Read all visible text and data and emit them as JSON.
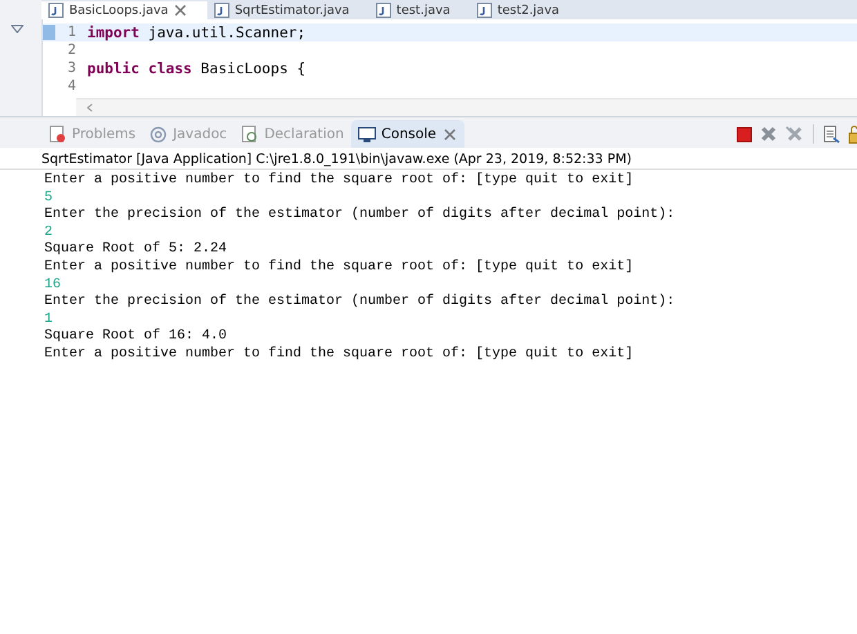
{
  "editor_tabs": [
    {
      "label": "BasicLoops.java",
      "selected": true,
      "closable": true
    },
    {
      "label": "SqrtEstimator.java",
      "selected": false,
      "closable": false
    },
    {
      "label": "test.java",
      "selected": false,
      "closable": false
    },
    {
      "label": "test2.java",
      "selected": false,
      "closable": false
    }
  ],
  "editor": {
    "lines": [
      {
        "number": "1",
        "tokens": [
          {
            "text": "import",
            "kind": "keyword"
          },
          {
            "text": " java.util.Scanner;",
            "kind": "plain"
          }
        ],
        "current": true
      },
      {
        "number": "2",
        "current": false
      },
      {
        "number": "3",
        "tokens": [
          {
            "text": "public class",
            "kind": "keyword"
          },
          {
            "text": " BasicLoops {",
            "kind": "plain"
          }
        ],
        "current": false
      },
      {
        "number": "4",
        "current": false
      }
    ]
  },
  "view_tabs": [
    {
      "label": "Problems",
      "selected": false,
      "closable": false
    },
    {
      "label": "Javadoc",
      "selected": false,
      "closable": false
    },
    {
      "label": "Declaration",
      "selected": false,
      "closable": false
    },
    {
      "label": "Console",
      "selected": true,
      "closable": true
    }
  ],
  "console": {
    "title": "SqrtEstimator [Java Application] C:\\jre1.8.0_191\\bin\\javaw.exe (Apr 23, 2019, 8:52:33 PM)",
    "lines": [
      {
        "text": "Enter a positive number to find the square root of: [type quit to exit]",
        "kind": "output"
      },
      {
        "text": "5",
        "kind": "input"
      },
      {
        "text": "Enter the precision of the estimator (number of digits after decimal point):",
        "kind": "output"
      },
      {
        "text": "2",
        "kind": "input"
      },
      {
        "text": "Square Root of 5: 2.24",
        "kind": "output"
      },
      {
        "text": "Enter a positive number to find the square root of: [type quit to exit]",
        "kind": "output"
      },
      {
        "text": "16",
        "kind": "input"
      },
      {
        "text": "Enter the precision of the estimator (number of digits after decimal point):",
        "kind": "output"
      },
      {
        "text": "1",
        "kind": "input"
      },
      {
        "text": "Square Root of 16: 4.0",
        "kind": "output"
      },
      {
        "text": "Enter a positive number to find the square root of: [type quit to exit]",
        "kind": "output"
      }
    ]
  }
}
